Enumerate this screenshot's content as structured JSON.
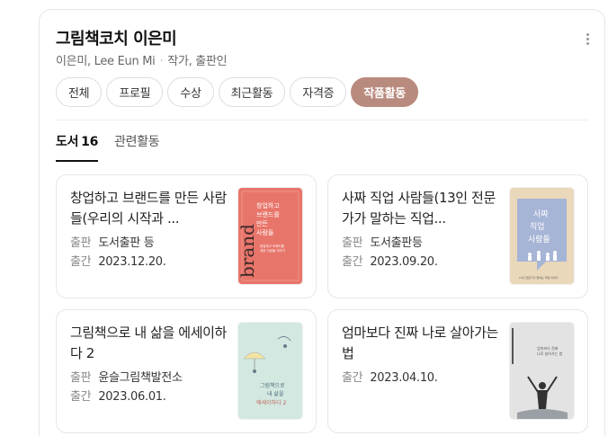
{
  "header": {
    "title": "그림책코치 이은미",
    "subtitle_name": "이은미, Lee Eun Mi",
    "subtitle_role": "작가, 출판인"
  },
  "chips": [
    "전체",
    "프로필",
    "수상",
    "최근활동",
    "자격증",
    "작품활동"
  ],
  "active_chip": "작품활동",
  "tabs": {
    "books_label": "도서",
    "books_count": "16",
    "activities_label": "관련활동"
  },
  "books": [
    {
      "title": "창업하고 브랜드를 만든 사람들(우리의 시작과 ...",
      "publisher_key": "출판",
      "publisher": "도서출판 등",
      "date_key": "출간",
      "date": "2023.12.20.",
      "cover_text": "창업하고 브랜드를 만든 사람들",
      "cover_big": "brand",
      "cover_color": "#e8756a"
    },
    {
      "title": "사짜 직업 사람들(13인 전문가가 말하는 직업...",
      "publisher_key": "출판",
      "publisher": "도서출판등",
      "date_key": "출간",
      "date": "2023.09.20.",
      "cover_text": "사짜 직업 사람들",
      "cover_color": "#e9d6b8"
    },
    {
      "title": "그림책으로 내 삶을 에세이하다 2",
      "publisher_key": "출판",
      "publisher": "윤슬그림책발전소",
      "date_key": "출간",
      "date": "2023.06.01.",
      "cover_text": "그림책으로 내 삶을 에세이하다 2",
      "cover_color": "#cfe6df"
    },
    {
      "title": "엄마보다 진짜 나로 살아가는 법",
      "date_key": "출간",
      "date": "2023.04.10.",
      "cover_text": "엄마보다 진짜 나로 살아가는 법",
      "cover_color": "#e4e4e4"
    }
  ],
  "colors": {
    "accent": "#b98a7e"
  }
}
